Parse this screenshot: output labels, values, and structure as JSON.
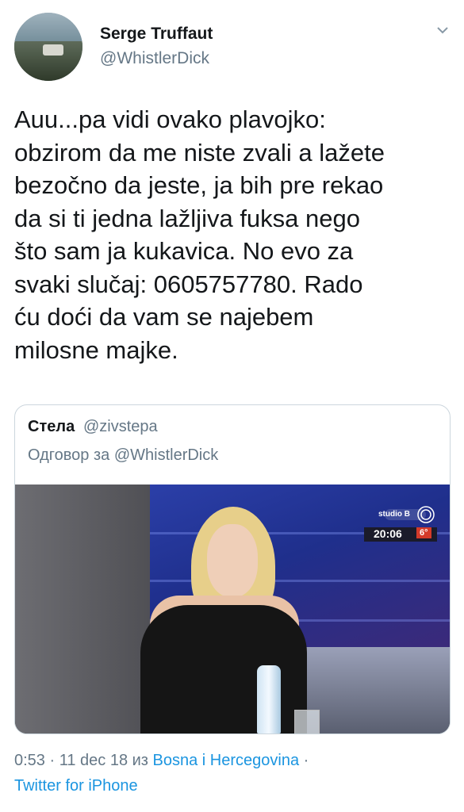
{
  "author": {
    "name": "Serge Truffaut",
    "handle": "@WhistlerDick"
  },
  "tweet": {
    "text": "Auu...pa vidi ovako plavojko:\nobzirom da me niste zvali a lažete\nbezočno da jeste, ja bih pre rekao\nda si ti jedna lažljiva fuksa nego\nšto sam ja kukavica. No evo za\nsvaki slučaj: 0605757780. Rado\nću doći da vam se najebem\nmilosne majke."
  },
  "quoted_tweet": {
    "name": "Стела",
    "handle": "@zivstepa",
    "reply_to": "Одговор за @WhistlerDick",
    "media": {
      "channel_logo": "studio B",
      "clock_time": "20:06",
      "clock_temp": "6°"
    }
  },
  "meta": {
    "time_date": "0:53 · 11 dec 18 из",
    "location": "Bosna i Hercegovina",
    "separator": "·",
    "source": "Twitter for iPhone"
  },
  "icons": {
    "menu": "chevron-down-icon"
  }
}
